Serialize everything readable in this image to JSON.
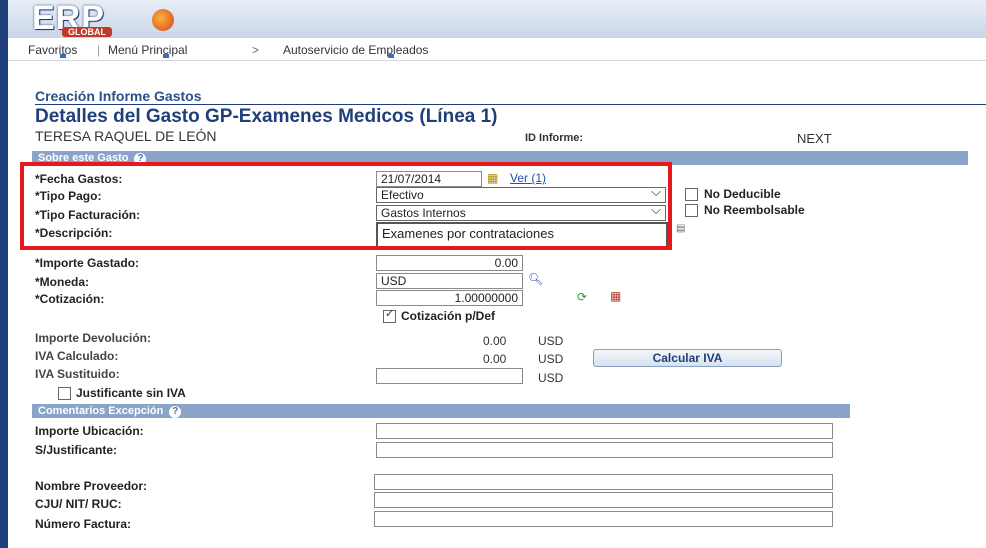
{
  "header": {
    "logo_main": "ERP",
    "logo_sub": "GLOBAL"
  },
  "nav": {
    "favoritos": "Favoritos",
    "sep": "|",
    "menu": "Menú Principal",
    "arrow": ">",
    "autoservicio": "Autoservicio de Empleados"
  },
  "page": {
    "title": "Creación Informe Gastos",
    "subtitle": "Detalles del Gasto GP-Examenes Medicos (Línea 1)",
    "employee": "TERESA RAQUEL DE LEÓN",
    "id_label": "ID Informe:",
    "id_value": "NEXT"
  },
  "section_gasto": {
    "title": "Sobre este Gasto",
    "help": "?"
  },
  "fields": {
    "fecha_label": "*Fecha Gastos:",
    "fecha_value": "21/07/2014",
    "ver_link": "Ver (1)",
    "tipo_pago_label": "*Tipo Pago:",
    "tipo_pago_value": "Efectivo",
    "tipo_fact_label": "*Tipo Facturación:",
    "tipo_fact_value": "Gastos Internos",
    "desc_label": "*Descripción:",
    "desc_value": "Examenes por contrataciones",
    "importe_label": "*Importe Gastado:",
    "importe_value": "0.00",
    "moneda_label": "*Moneda:",
    "moneda_value": "USD",
    "cotiz_label": "*Cotización:",
    "cotiz_value": "1.00000000",
    "cotiz_def_label": "Cotización p/Def",
    "no_deducible": "No Deducible",
    "no_reembolsable": "No Reembolsable",
    "devol_label": "Importe Devolución:",
    "devol_value": "0.00",
    "devol_cur": "USD",
    "iva_calc_label": "IVA Calculado:",
    "iva_calc_value": "0.00",
    "iva_calc_cur": "USD",
    "calc_iva_button": "Calcular IVA",
    "iva_sust_label": "IVA Sustituido:",
    "iva_sust_cur": "USD",
    "just_sin_iva": "Justificante sin IVA"
  },
  "section_excepcion": {
    "title": "Comentarios Excepción",
    "help": "?"
  },
  "excepcion": {
    "ubicacion_label": "Importe Ubicación:",
    "sjust_label": "S/Justificante:",
    "proveedor_label": "Nombre Proveedor:",
    "nit_label": "CJU/ NIT/ RUC:",
    "factura_label": "Número Factura:"
  },
  "colors": {
    "highlight": "#e8191c",
    "brand": "#1f3f7a",
    "section": "#8aa4c9"
  }
}
